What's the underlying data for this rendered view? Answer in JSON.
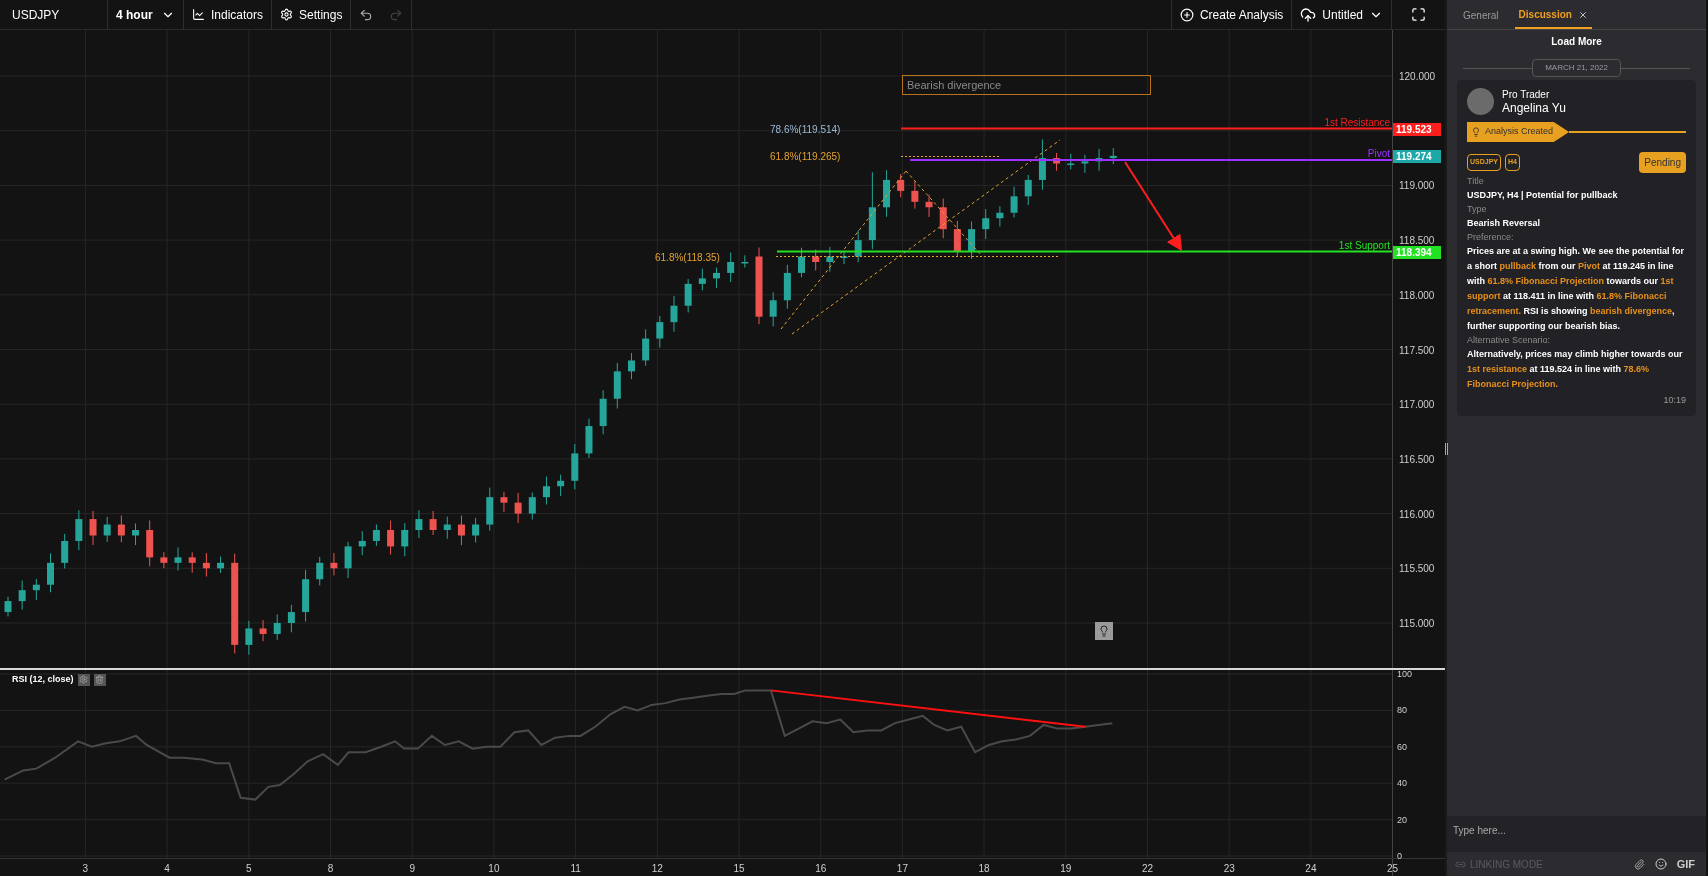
{
  "toolbar": {
    "symbol": "USDJPY",
    "timeframe": "4 hour",
    "indicators": "Indicators",
    "settings": "Settings",
    "undo_disabled": false,
    "redo_disabled": true,
    "create_analysis": "Create Analysis",
    "layout_name": "Untitled"
  },
  "chart": {
    "price_axis": [
      "120.000",
      "119.000",
      "118.500",
      "118.000",
      "117.500",
      "117.000",
      "116.500",
      "116.000",
      "115.500",
      "115.000"
    ],
    "annotation_box": "Bearish divergence",
    "levels": [
      {
        "kind": "resistance",
        "name": "1st Resistance",
        "price_tag": "119.523",
        "color": "#ff1e1e"
      },
      {
        "kind": "pivot",
        "name": "Pivot",
        "price_tag": "119.274",
        "color": "#9b30ff"
      },
      {
        "kind": "support",
        "name": "1st Support",
        "price_tag": "118.394",
        "color": "#22e022"
      }
    ],
    "fib_labels": [
      {
        "text": "78.6%(119.514)",
        "color": "#9db9d6"
      },
      {
        "text": "61.8%(119.265)",
        "color": "#e3a232"
      },
      {
        "text": "61.8%(118.35)",
        "color": "#e3a232"
      }
    ],
    "time_axis": [
      "3",
      "4",
      "5",
      "8",
      "9",
      "10",
      "11",
      "12",
      "15",
      "16",
      "17",
      "18",
      "19",
      "22",
      "23",
      "24",
      "25"
    ]
  },
  "rsi": {
    "label": "RSI (12, close)",
    "axis": [
      "100",
      "80",
      "60",
      "40",
      "20",
      "0"
    ]
  },
  "panel": {
    "tabs": [
      {
        "label": "General",
        "selected": false,
        "closable": false
      },
      {
        "label": "Discussion",
        "selected": true,
        "closable": true
      }
    ],
    "load_more": "Load More",
    "date": "MARCH 21, 2022",
    "post": {
      "role": "Pro Trader",
      "author": "Angelina Yu",
      "event": "Analysis Created",
      "tags": [
        "USDJPY",
        "H4"
      ],
      "status": "Pending",
      "fields": [
        {
          "label": "Title",
          "value": [
            {
              "text": "USDJPY, H4 | Potential for pullback",
              "highlight": false
            }
          ]
        },
        {
          "label": "Type",
          "value": [
            {
              "text": "Bearish Reversal",
              "highlight": false
            }
          ]
        },
        {
          "label": "Preference:",
          "value": [
            {
              "text": "Prices are at a swing high. We see the potential for a short ",
              "highlight": false
            },
            {
              "text": "pullback",
              "highlight": true
            },
            {
              "text": " from our ",
              "highlight": false
            },
            {
              "text": "Pivot",
              "highlight": true
            },
            {
              "text": " at 119.245 in line with ",
              "highlight": false
            },
            {
              "text": "61.8% Fibonacci Projection",
              "highlight": true
            },
            {
              "text": " towards our ",
              "highlight": false
            },
            {
              "text": "1st support",
              "highlight": true
            },
            {
              "text": " at 118.411 in line with ",
              "highlight": false
            },
            {
              "text": "61.8% Fibonacci retracement.",
              "highlight": true
            },
            {
              "text": " RSI is showing ",
              "highlight": false
            },
            {
              "text": "bearish divergence",
              "highlight": true
            },
            {
              "text": ", further supporting our bearish bias.",
              "highlight": false
            }
          ]
        },
        {
          "label": "Alternative Scenario:",
          "value": [
            {
              "text": "Alternatively, prices may climb higher towards our ",
              "highlight": false
            },
            {
              "text": "1st resistance",
              "highlight": true
            },
            {
              "text": " at 119.524 in line with ",
              "highlight": false
            },
            {
              "text": "78.6% Fibonacci Projection.",
              "highlight": true
            }
          ]
        }
      ],
      "time": "10:19"
    },
    "composer": {
      "placeholder": "Type here...",
      "linking_mode": "LINKING MODE",
      "linking_enabled": false,
      "gif": "GIF"
    }
  }
}
